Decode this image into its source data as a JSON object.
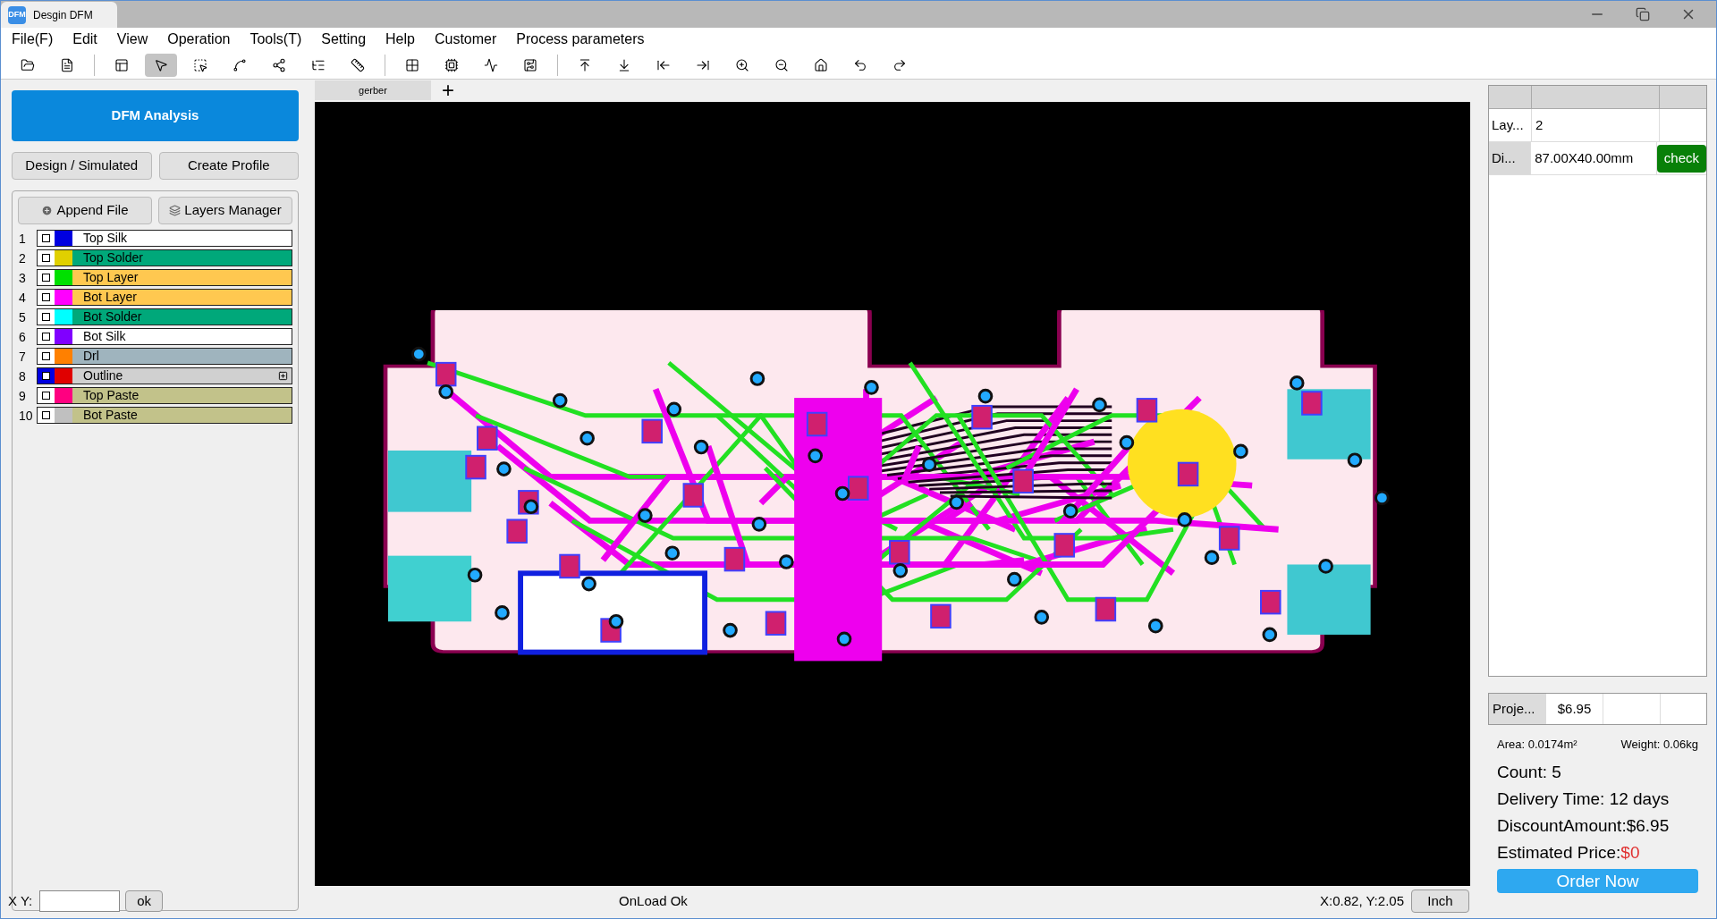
{
  "window": {
    "title": "Desgin DFM",
    "app_icon": "DFM"
  },
  "menu": [
    "File(F)",
    "Edit",
    "View",
    "Operation",
    "Tools(T)",
    "Setting",
    "Help",
    "Customer",
    "Process parameters"
  ],
  "toolbar": [
    {
      "selected": false
    },
    {
      "selected": false
    },
    {
      "selected": false
    },
    {
      "selected": true
    },
    {
      "selected": false
    },
    {
      "selected": false
    },
    {
      "selected": false
    },
    {
      "selected": false
    },
    {
      "selected": false
    },
    {
      "selected": false
    },
    {
      "selected": false
    },
    {
      "selected": false
    },
    {
      "selected": false
    },
    {
      "selected": false
    },
    {
      "selected": false
    },
    {
      "selected": false
    },
    {
      "selected": false
    },
    {
      "selected": false
    },
    {
      "selected": false
    },
    {
      "selected": false
    },
    {
      "selected": false
    },
    {
      "selected": false
    }
  ],
  "left_panel": {
    "analysis_button": "DFM Analysis",
    "buttons": [
      "Design / Simulated",
      "Create Profile"
    ],
    "append_button": "Append File",
    "layers_button": "Layers Manager",
    "layers": [
      {
        "index": "1",
        "selected": false,
        "color": "#0000e0",
        "name": {
          "text": "Top Silk",
          "color": "#ffffff"
        },
        "expandable": false
      },
      {
        "index": "2",
        "selected": false,
        "color": "#e0d000",
        "name": {
          "text": "Top Solder",
          "color": "#00a87a"
        },
        "expandable": false
      },
      {
        "index": "3",
        "selected": false,
        "color": "#00e000",
        "name": {
          "text": "Top Layer",
          "color": "#ffc850"
        },
        "expandable": false
      },
      {
        "index": "4",
        "selected": false,
        "color": "#ff00ff",
        "name": {
          "text": "Bot Layer",
          "color": "#ffc850"
        },
        "expandable": false
      },
      {
        "index": "5",
        "selected": false,
        "color": "#00ffff",
        "name": {
          "text": "Bot Solder",
          "color": "#00a87a"
        },
        "expandable": false
      },
      {
        "index": "6",
        "selected": false,
        "color": "#8000ff",
        "name": {
          "text": "Bot Silk",
          "color": "#ffffff"
        },
        "expandable": false
      },
      {
        "index": "7",
        "selected": false,
        "color": "#ff8000",
        "name": {
          "text": "Drl",
          "color": "#9fb4be"
        },
        "expandable": false
      },
      {
        "index": "8",
        "selected": true,
        "color": "#e00000",
        "name": {
          "text": "Outline",
          "color": "#d0d0d0"
        },
        "expandable": true
      },
      {
        "index": "9",
        "selected": false,
        "color": "#ff0080",
        "name": {
          "text": "Top Paste",
          "color": "#c2c28a"
        },
        "expandable": false
      },
      {
        "index": "10",
        "selected": false,
        "color": "#c0c0c0",
        "name": {
          "text": "Bot Paste",
          "color": "#c2c28a"
        },
        "expandable": false
      }
    ]
  },
  "canvas": {
    "tabs": [
      {
        "label": "gerber",
        "selected": true
      }
    ],
    "add_tab": "+"
  },
  "right_panel": {
    "table": {
      "rows": [
        {
          "label": "Lay...",
          "value": "2",
          "selected": false
        },
        {
          "label": "Di...",
          "value": "87.00X40.00mm",
          "button": "check",
          "selected": true
        }
      ]
    },
    "project": {
      "label": "Proje...",
      "value": "$6.95"
    },
    "area": "Area: 0.0174m²",
    "weight": "Weight: 0.06kg",
    "count": "Count: 5",
    "delivery": "Delivery Time: 12 days",
    "discount": "DiscountAmount:$6.95",
    "estimated_label": "Estimated Price:",
    "estimated_value": "$0",
    "order_button": "Order Now"
  },
  "status_bar": {
    "xy_label": "X Y:",
    "ok_button": "ok",
    "message": "OnLoad Ok",
    "coords": "X:0.82, Y:2.05",
    "unit_button": "Inch"
  }
}
